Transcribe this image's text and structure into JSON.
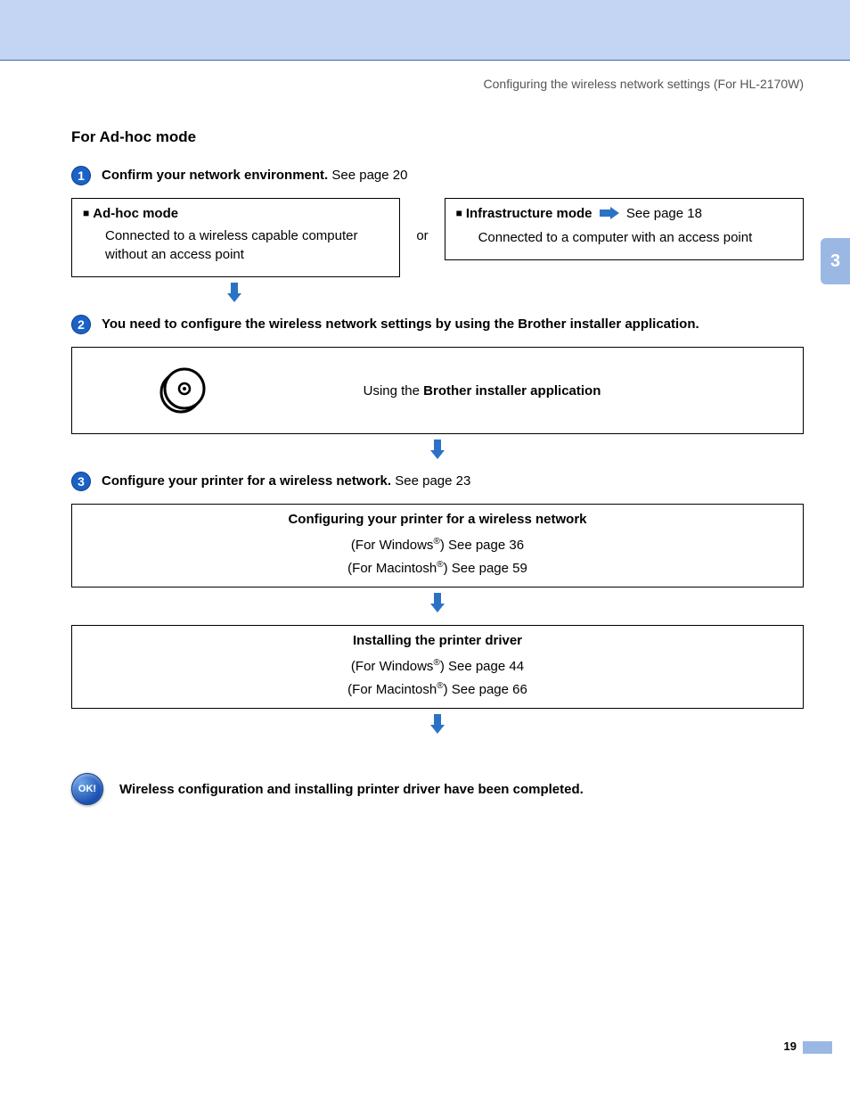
{
  "header": "Configuring the wireless network settings (For HL-2170W)",
  "sectionTitle": "For Ad-hoc mode",
  "sideTab": "3",
  "pageNumber": "19",
  "step1": {
    "num": "1",
    "bold": "Confirm your network environment.",
    "rest": " See page 20"
  },
  "adhoc": {
    "title": "Ad-hoc mode",
    "desc": "Connected to a wireless capable computer without an access point"
  },
  "orText": "or",
  "infra": {
    "title": "Infrastructure mode",
    "link": " See page 18",
    "desc": "Connected to a computer with an access point"
  },
  "step2": {
    "num": "2",
    "bold": "You need to configure the wireless network settings by using the Brother installer application."
  },
  "installer": {
    "prefix": "Using the ",
    "bold": "Brother installer application"
  },
  "step3": {
    "num": "3",
    "bold": "Configure your printer for a wireless network.",
    "rest": " See page 23"
  },
  "configBox": {
    "title": "Configuring your printer for a wireless network",
    "winPrefix": "(For Windows",
    "winSuffix": ") See page 36",
    "macPrefix": "(For Macintosh",
    "macSuffix": ") See page 59"
  },
  "driverBox": {
    "title": "Installing the printer driver",
    "winPrefix": "(For Windows",
    "winSuffix": ") See page 44",
    "macPrefix": "(For Macintosh",
    "macSuffix": ") See page 66"
  },
  "okBadge": "OK!",
  "okText": "Wireless configuration and installing printer driver have been completed.",
  "reg": "®"
}
